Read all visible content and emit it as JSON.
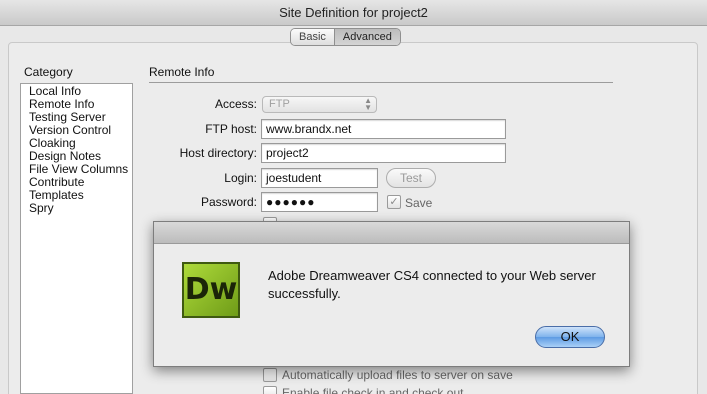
{
  "window": {
    "title": "Site Definition for project2"
  },
  "mode_tabs": [
    {
      "label": "Basic",
      "active": false
    },
    {
      "label": "Advanced",
      "active": true
    }
  ],
  "category": {
    "heading": "Category",
    "items": [
      "Local Info",
      "Remote Info",
      "Testing Server",
      "Version Control",
      "Cloaking",
      "Design Notes",
      "File View Columns",
      "Contribute",
      "Templates",
      "Spry"
    ]
  },
  "remote_info": {
    "title": "Remote Info",
    "access": {
      "label": "Access:",
      "value": "FTP"
    },
    "ftp_host": {
      "label": "FTP host:",
      "value": "www.brandx.net"
    },
    "host_directory": {
      "label": "Host directory:",
      "value": "project2"
    },
    "login": {
      "label": "Login:",
      "value": "joestudent",
      "test_label": "Test"
    },
    "password": {
      "label": "Password:",
      "value": "●●●●●●",
      "save_label": "Save",
      "save_checked": true
    },
    "auto_upload": {
      "label": "Automatically upload files to server on save",
      "checked": false
    },
    "file_check": {
      "label": "Enable file check in and check out",
      "checked": false
    }
  },
  "dialog": {
    "icon_text": "Dw",
    "message": "Adobe Dreamweaver CS4 connected to your Web server successfully.",
    "ok_label": "OK"
  }
}
